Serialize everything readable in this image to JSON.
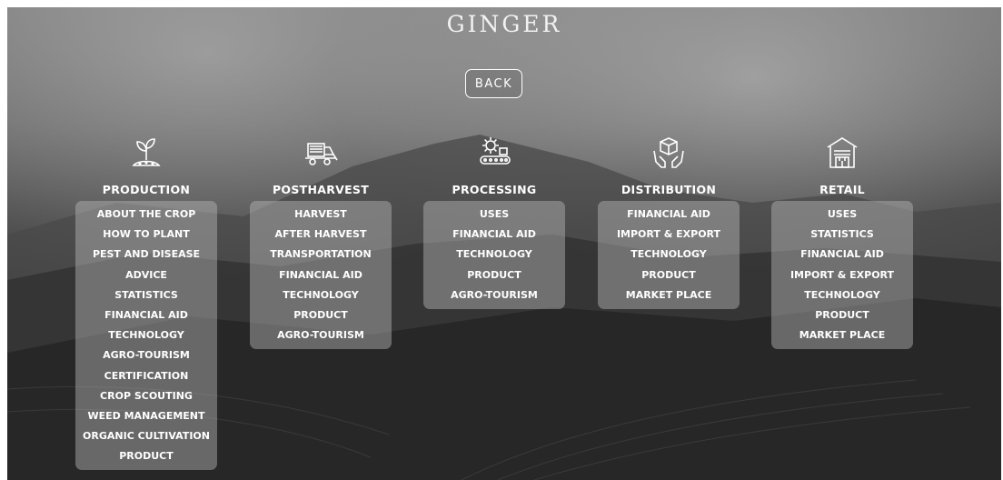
{
  "page": {
    "title": "GINGER",
    "back_label": "BACK"
  },
  "columns": [
    {
      "heading": "PRODUCTION",
      "icon": "seedling-icon",
      "items": [
        "ABOUT THE CROP",
        "HOW TO PLANT",
        "PEST AND DISEASE",
        "ADVICE",
        "STATISTICS",
        "FINANCIAL AID",
        "TECHNOLOGY",
        "AGRO-TOURISM",
        "CERTIFICATION",
        "CROP SCOUTING",
        "WEED MANAGEMENT",
        "ORGANIC CULTIVATION",
        "PRODUCT"
      ]
    },
    {
      "heading": "POSTHARVEST",
      "icon": "harvester-icon",
      "items": [
        "HARVEST",
        "AFTER HARVEST",
        "TRANSPORTATION",
        "FINANCIAL AID",
        "TECHNOLOGY",
        "PRODUCT",
        "AGRO-TOURISM"
      ]
    },
    {
      "heading": "PROCESSING",
      "icon": "conveyor-gear-icon",
      "items": [
        "USES",
        "FINANCIAL AID",
        "TECHNOLOGY",
        "PRODUCT",
        "AGRO-TOURISM"
      ]
    },
    {
      "heading": "DISTRIBUTION",
      "icon": "hands-box-icon",
      "items": [
        "FINANCIAL AID",
        "IMPORT & EXPORT",
        "TECHNOLOGY",
        "PRODUCT",
        "MARKET PLACE"
      ]
    },
    {
      "heading": "RETAIL",
      "icon": "warehouse-icon",
      "items": [
        "USES",
        "STATISTICS",
        "FINANCIAL AID",
        "IMPORT & EXPORT",
        "TECHNOLOGY",
        "PRODUCT",
        "MARKET PLACE"
      ]
    }
  ]
}
